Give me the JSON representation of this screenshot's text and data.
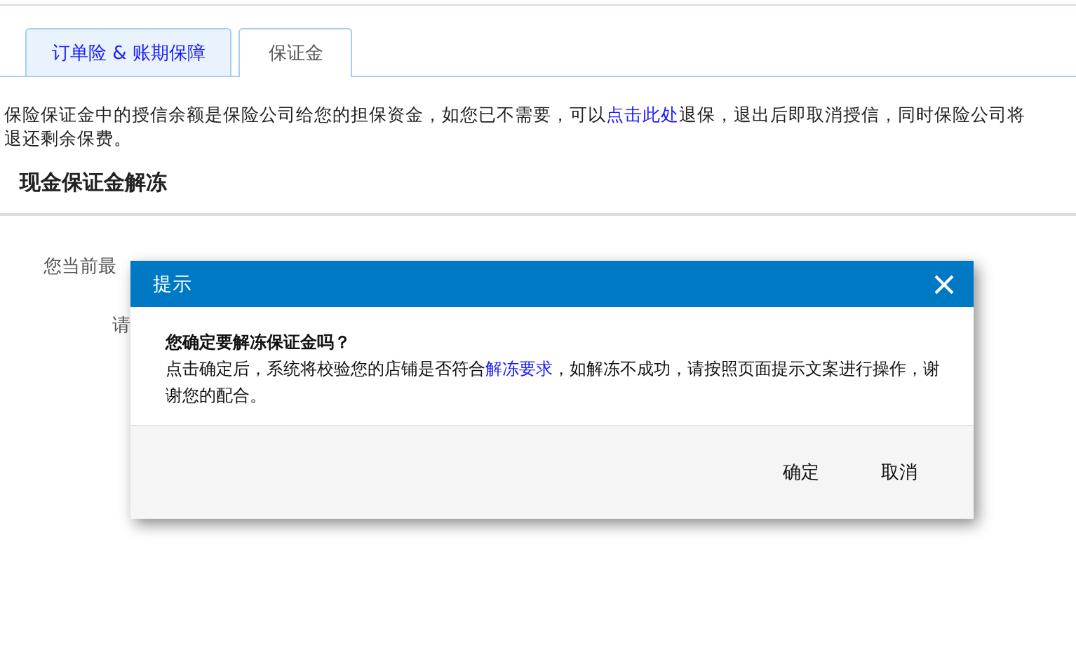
{
  "tabs": [
    {
      "label": "订单险 & 账期保障",
      "selected": false
    },
    {
      "label": "保证金",
      "selected": true
    }
  ],
  "notice": {
    "before": "保险保证金中的授信余额是保险公司给您的担保资金，如您已不需要，可以",
    "link": "点击此处",
    "after": "退保，退出后即取消授信，同时保险公司将退还剩余保费。"
  },
  "section": {
    "title": "现金保证金解冻",
    "lines": [
      "您当前最",
      "请"
    ]
  },
  "dialog": {
    "title": "提示",
    "question": "您确定要解冻保证金吗？",
    "message_before": "点击确定后，系统将校验您的店铺是否符合",
    "message_link": "解冻要求",
    "message_after": "，如解冻不成功，请按照页面提示文案进行操作，谢谢您的配合。",
    "buttons": [
      "确定",
      "取消"
    ]
  }
}
